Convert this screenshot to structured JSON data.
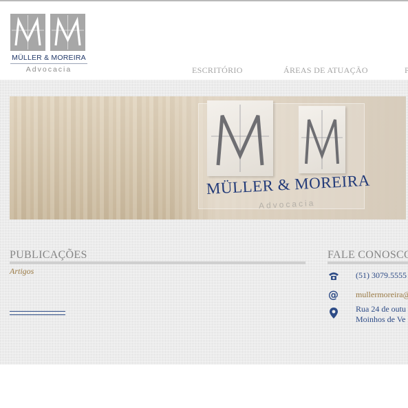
{
  "logo": {
    "name": "MÜLLER & MOREIRA",
    "sub": "Advocacia"
  },
  "nav": {
    "items": [
      {
        "label": "ESCRITÓRIO"
      },
      {
        "label": "ÁREAS DE ATUAÇÃO"
      },
      {
        "label": "P"
      }
    ]
  },
  "hero": {
    "name": "MÜLLER & MOREIRA",
    "sub": "Advocacia"
  },
  "publicacoes": {
    "title": "PUBLICAÇÕES",
    "link": "Artigos"
  },
  "contact": {
    "title": "FALE CONOSCO",
    "phone": "(51) 3079.5555",
    "email": "mullermoreira@",
    "address_line1": "Rua 24 de outu",
    "address_line2": "Moinhos de Ve"
  },
  "colors": {
    "brand_blue": "#2d4b86",
    "accent_gold": "#9a7a45",
    "nav_gray": "#a5a5a5"
  },
  "icons": [
    "phone-icon",
    "at-icon",
    "map-pin-icon"
  ]
}
